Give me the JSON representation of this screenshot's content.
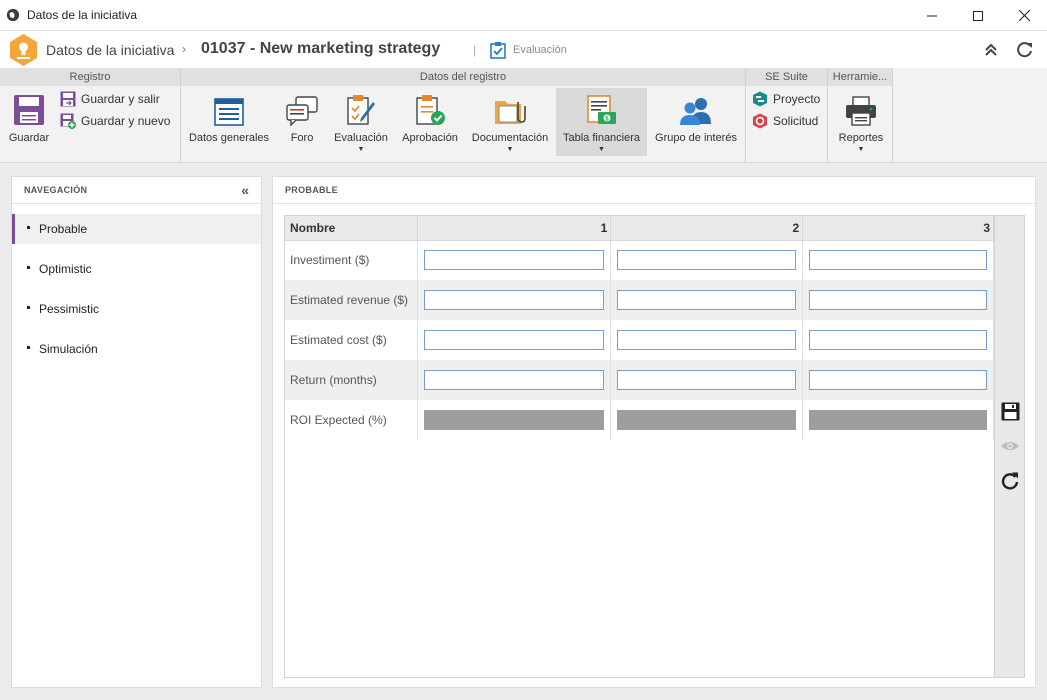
{
  "window": {
    "title": "Datos de la iniciativa"
  },
  "header": {
    "breadcrumb_root": "Datos de la iniciativa",
    "record_title": "01037 - New marketing strategy",
    "status_label": "Evaluación"
  },
  "ribbon": {
    "groups": {
      "registro": "Registro",
      "datos": "Datos del registro",
      "suite": "SE Suite",
      "herramientas": "Herramie..."
    },
    "guardar": "Guardar",
    "guardar_salir": "Guardar y salir",
    "guardar_nuevo": "Guardar y nuevo",
    "datos_generales": "Datos generales",
    "foro": "Foro",
    "evaluacion": "Evaluación",
    "aprobacion": "Aprobación",
    "documentacion": "Documentación",
    "tabla_financiera": "Tabla financiera",
    "grupo_interes": "Grupo de interés",
    "proyecto": "Proyecto",
    "solicitud": "Solicitud",
    "reportes": "Reportes"
  },
  "nav": {
    "title": "NAVEGACIÓN",
    "items": [
      {
        "label": "Probable"
      },
      {
        "label": "Optimistic"
      },
      {
        "label": "Pessimistic"
      },
      {
        "label": "Simulación"
      }
    ]
  },
  "main": {
    "title": "PROBABLE",
    "table": {
      "header": [
        "Nombre",
        "1",
        "2",
        "3"
      ],
      "rows": [
        {
          "label": "Investiment ($)",
          "values": [
            "",
            "",
            ""
          ]
        },
        {
          "label": "Estimated revenue ($)",
          "values": [
            "",
            "",
            ""
          ]
        },
        {
          "label": "Estimated cost ($)",
          "values": [
            "",
            "",
            ""
          ]
        },
        {
          "label": "Return (months)",
          "values": [
            "",
            "",
            ""
          ]
        },
        {
          "label": "ROI Expected (%)",
          "values": [
            "",
            "",
            ""
          ]
        }
      ]
    }
  },
  "colors": {
    "accent": "#7c4d98",
    "logo": "#f3a73b",
    "input_border": "#7a9cc6"
  }
}
